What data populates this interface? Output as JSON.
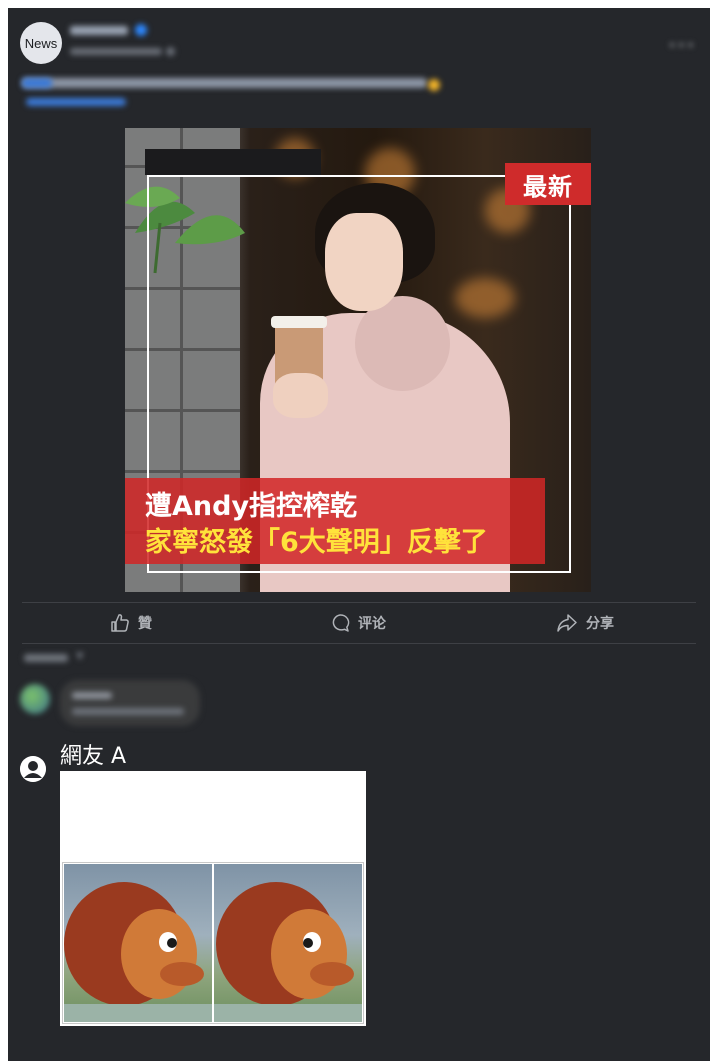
{
  "post": {
    "avatar_text": "News",
    "more_icon": "more-horizontal-icon"
  },
  "image": {
    "badge": "最新",
    "headline_line1": "遭Andy指控榨乾",
    "headline_line2": "家寧怒發「6大聲明」反擊了",
    "colors": {
      "badge_bg": "#cf2b2b",
      "headline_bg": "#d22626",
      "headline_line2_color": "#ffe23b"
    }
  },
  "actions": [
    {
      "label": "贊",
      "icon": "thumbs-up-icon"
    },
    {
      "label": "评论",
      "icon": "comment-bubble-icon"
    },
    {
      "label": "分享",
      "icon": "share-arrow-icon"
    }
  ],
  "reply": {
    "user_name": "網友 A",
    "avatar_icon": "default-user-icon"
  },
  "colors": {
    "card_bg": "#25272b",
    "text_muted": "#b0b3b8",
    "link_blue": "#3b79d6"
  }
}
